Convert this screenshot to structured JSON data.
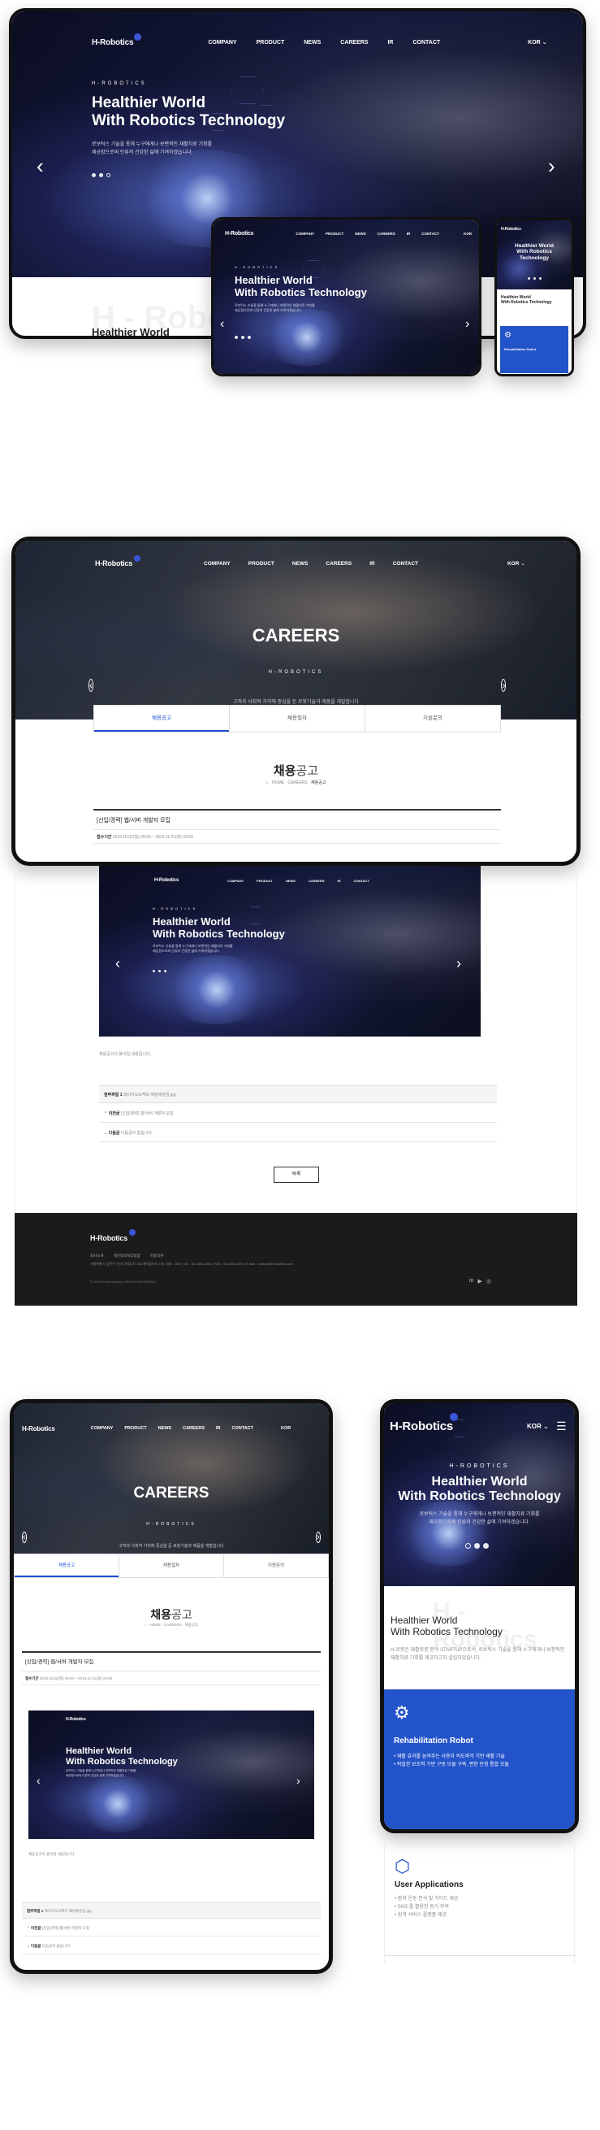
{
  "brand": "H-Robotics",
  "nav": {
    "company": "COMPANY",
    "product": "PRODUCT",
    "news": "NEWS",
    "careers": "CAREERS",
    "ir": "IR",
    "contact": "CONTACT",
    "lang": "KOR"
  },
  "hero": {
    "eyebrow": "H-ROBOTICS",
    "title1": "Healthier World",
    "title2": "With Robotics Technology",
    "desc1": "로보틱스 기술을 통해 누구에게나 보편적인 재활치료 기회를",
    "desc2": "제공함으로써 인류의 건강한 삶에 기여하겠습니다."
  },
  "section1": {
    "title1": "Healthier World",
    "title2": "With Robotics Technology",
    "ghost": "H - Robotics"
  },
  "careers": {
    "title": "CAREERS",
    "sub": "H-ROBOTICS",
    "desc": "고객과 사회적 가치에 중심을 둔 로봇기술과 제품을 개발합니다",
    "tabs": [
      "채용공고",
      "채용절차",
      "지원문의"
    ],
    "page_title_bold": "채용",
    "page_title_light": "공고",
    "crumb_home": "HOME",
    "crumb_mid": "CAREERS",
    "crumb_cur": "채용공고",
    "post_title": "[신입/경력] 웹/서버 개발자 모집",
    "period_label": "접수기간",
    "period": "2019.10.02(월) 09:00 ~ 2019.11.01(화) 23:59",
    "body_text": "채용공고의 풀이입 내용입니다.",
    "file_label": "첨부파일 1",
    "file_name": "메이저오브젝트 채팅예정임.jpg",
    "prev_label": "이전글",
    "prev_title": "[신입/경력] 웹/서버 개발자 모집",
    "next_label": "다음글",
    "next_title": "다음글이 없습니다.",
    "list_btn": "목록"
  },
  "footer": {
    "links": [
      "회사소개",
      "개인정보처리방침",
      "이용약관"
    ],
    "address": "서울특별시 금천구 가산디지털1로 186 제이플라츠 1층 | 대표 : 000 | TEL : 02-0000-0000 | FAX : 02-0000-0000 | E-mail : contact@h-robotics.com",
    "copy": "© 2019 H-Robotics ALL RIGHTS RESERVED"
  },
  "mobile": {
    "rehab": "Rehabilitation Robot",
    "rehab_b1": "재활 효과를 높여주는 사용자 의도파악 기반 재활 기술",
    "rehab_b2": "적절한 보조력 기반 구동 모듈 구축, 편한 안정 통합 모듈",
    "apps": "User Applications",
    "apps_b1": "환자 운동 분석 및 가이드 제공",
    "apps_b2": "SNS 를 활용한 동기 부여",
    "apps_b3": "원격 서비스 플랫폼 제공",
    "intro": "H-로봇은 재활로봇 분야 STARTUP으로서, 로보틱스 기술을 통해 누구에게나 보편적인 재활치료 기회를 제공하고자 설립되었습니다.",
    "ghost": "H - Robotics"
  }
}
